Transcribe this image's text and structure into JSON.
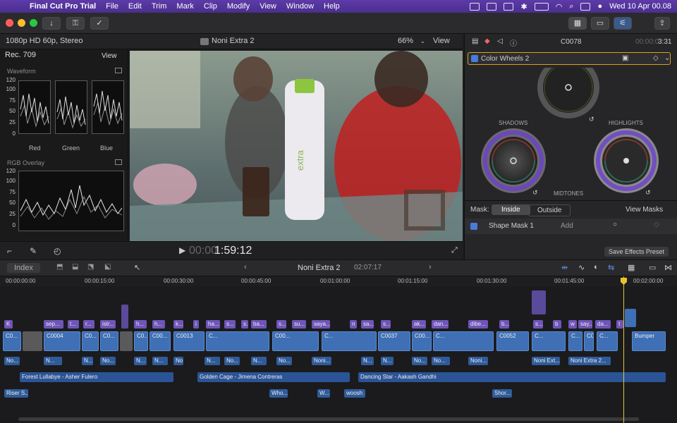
{
  "menubar": {
    "items": [
      "Final Cut Pro Trial",
      "File",
      "Edit",
      "Trim",
      "Mark",
      "Clip",
      "Modify",
      "View",
      "Window",
      "Help"
    ],
    "clock": "Wed 10 Apr  00.08"
  },
  "viewer_header": {
    "format": "1080p HD 60p, Stereo",
    "project": "Noni Extra 2",
    "zoom": "66%",
    "view": "View"
  },
  "scopes": {
    "color_space": "Rec. 709",
    "view": "View",
    "waveform_label": "Waveform",
    "waveform_ticks": [
      "120",
      "100",
      "75",
      "50",
      "25",
      "0"
    ],
    "channels": [
      "Red",
      "Green",
      "Blue"
    ],
    "overlay_label": "RGB Overlay",
    "overlay_ticks": [
      "120",
      "100",
      "75",
      "50",
      "25",
      "0"
    ]
  },
  "viewer_footer": {
    "timecode": "1:59:12",
    "timecode_dim": "00:00"
  },
  "inspector": {
    "clip_name": "C0078",
    "duration": "3:31",
    "duration_dim": "00:00:0",
    "effect": "Color Wheels 2",
    "wheel_labels": [
      "SHADOWS",
      "HIGHLIGHTS",
      "MIDTONES"
    ],
    "mask_label": "Mask:",
    "mask_inside": "Inside",
    "mask_outside": "Outside",
    "view_masks": "View Masks",
    "shape_mask": "Shape Mask 1",
    "add": "Add",
    "save_preset": "Save Effects Preset"
  },
  "timeline_header": {
    "index": "Index",
    "project": "Noni Extra 2",
    "duration": "02:07:17"
  },
  "ruler": {
    "labels": [
      "00:00:00:00",
      "00:00:15:00",
      "00:00:30:00",
      "00:00:45:00",
      "00:01:00:00",
      "00:01:15:00",
      "00:01:30:00",
      "00:01:45:00",
      "00:02:00:00"
    ]
  },
  "titles": [
    "K",
    "sep...",
    "t...",
    "r...",
    "istr...",
    "h...",
    "h...",
    "k...",
    "i",
    "ha...",
    "s...",
    "s...",
    "ba...",
    "s...",
    "su...",
    "saya...",
    "n",
    "sa...",
    "s...",
    "ak...",
    "dan...",
    "dibe...",
    "b...",
    "s...",
    "b",
    "w",
    "say...",
    "da...",
    "t"
  ],
  "video_clips": [
    "C0...",
    "C0004",
    "C0...",
    "C0...",
    "C0...",
    "C00...",
    "C0013",
    "C...",
    "C00...",
    "C...",
    "C0037",
    "C00...",
    "C...",
    "C0052",
    "C...",
    "C...",
    "C0...",
    "C...",
    "Bumper"
  ],
  "audio_clips": [
    "No...",
    "N...",
    "N...",
    "No...",
    "N...",
    "N...",
    "No...",
    "N...",
    "No...",
    "N...",
    "No...",
    "Noni...",
    "N...",
    "N...",
    "No...",
    "No...",
    "Noni...",
    "Noni Ext...",
    "Noni Extra 2..."
  ],
  "music_clips": [
    "Forest Lullabye - Asher Fulero",
    "Golden Cage - Jimena Contreras",
    "Dancing Star - Aakash Gandhi"
  ],
  "sfx_clips": [
    "Riser S...",
    "Who...",
    "W...",
    "woosh",
    "Shor..."
  ],
  "colors": {
    "accent": "#e8c52b",
    "menubar": "#5e3aa8",
    "title_clip": "#6e55b8",
    "video_clip": "#3f6fb5"
  }
}
